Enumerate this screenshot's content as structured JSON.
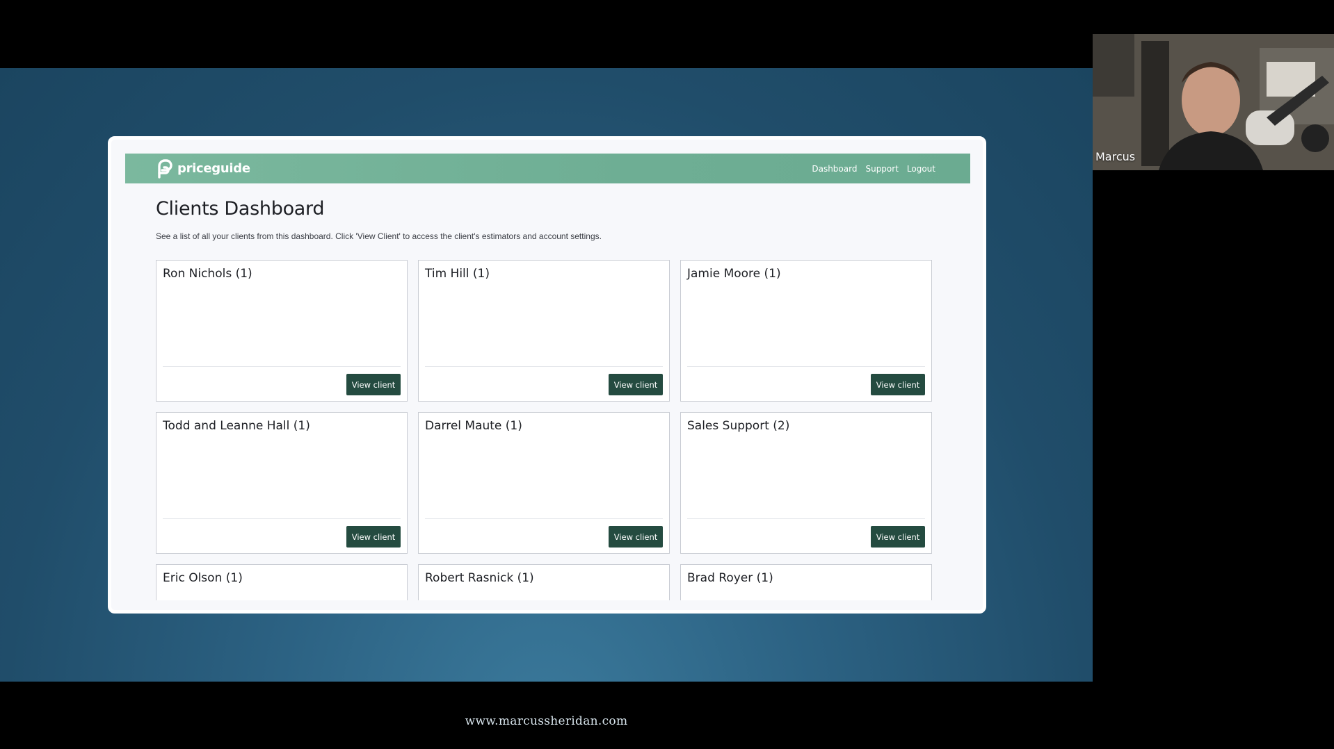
{
  "footer": {
    "url": "www.marcussheridan.com"
  },
  "webcam": {
    "participant_name": "Marcus"
  },
  "app": {
    "brand": "priceguide",
    "nav": {
      "dashboard": "Dashboard",
      "support": "Support",
      "logout": "Logout"
    },
    "title": "Clients Dashboard",
    "description": "See a list of all your clients from this dashboard. Click 'View Client' to access the client's estimators and account settings.",
    "view_button_label": "View client",
    "clients": [
      {
        "name": "Ron Nichols (1)"
      },
      {
        "name": "Tim Hill (1)"
      },
      {
        "name": "Jamie Moore (1)"
      },
      {
        "name": "Todd and Leanne Hall (1)"
      },
      {
        "name": "Darrel Maute (1)"
      },
      {
        "name": "Sales Support (2)"
      },
      {
        "name": "Eric Olson (1)"
      },
      {
        "name": "Robert Rasnick (1)"
      },
      {
        "name": "Brad Royer (1)"
      }
    ],
    "colors": {
      "navbar": "#6eae94",
      "button": "#244b40",
      "background": "#f7f8fb"
    }
  }
}
